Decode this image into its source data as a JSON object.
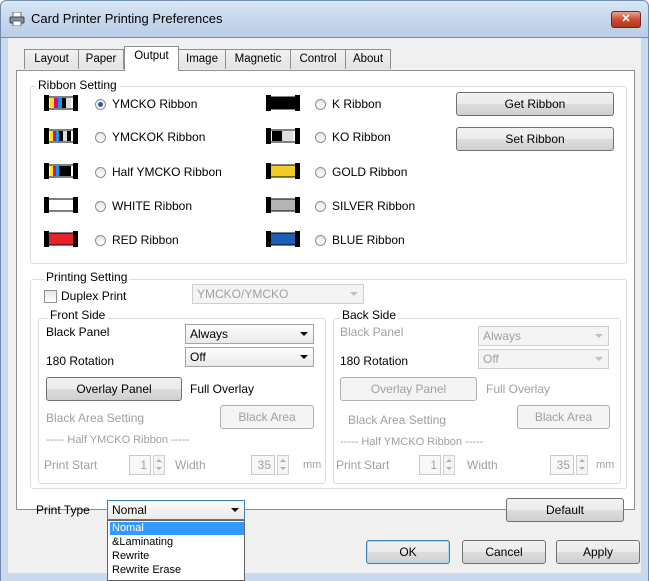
{
  "window": {
    "title": "Card Printer Printing Preferences",
    "close_label": "✕"
  },
  "tabs": [
    "Layout",
    "Paper",
    "Output",
    "Image",
    "Magnetic",
    "Control",
    "About"
  ],
  "ribbon_setting": {
    "legend": "Ribbon Setting",
    "left": [
      "YMCKO Ribbon",
      "YMCKOK Ribbon",
      "Half YMCKO Ribbon",
      "WHITE Ribbon",
      "RED Ribbon"
    ],
    "right": [
      "K Ribbon",
      "KO Ribbon",
      "GOLD Ribbon",
      "SILVER Ribbon",
      "BLUE Ribbon"
    ],
    "selected": "YMCKO Ribbon",
    "get_button": "Get Ribbon",
    "set_button": "Set Ribbon",
    "colors": {
      "red": "#e8222a",
      "gold": "#f2cc22",
      "silver": "#b4b4b4",
      "blue": "#1d5eb6",
      "black": "#000000"
    }
  },
  "printing_setting": {
    "legend": "Printing Setting",
    "duplex_label": "Duplex Print",
    "duplex_checked": false,
    "duplex_mode": "YMCKO/YMCKO",
    "front": {
      "legend": "Front Side",
      "black_panel_label": "Black Panel",
      "black_panel_value": "Always",
      "rotation_label": "180 Rotation",
      "rotation_value": "Off",
      "overlay_button": "Overlay Panel",
      "overlay_value": "Full Overlay",
      "black_area_label": "Black Area Setting",
      "black_area_button": "Black Area",
      "half_label": "----- Half YMCKO Ribbon -----",
      "print_start_label": "Print Start",
      "print_start_value": "1",
      "width_label": "Width",
      "width_value": "35",
      "unit": "mm"
    },
    "back": {
      "legend": "Back Side",
      "black_panel_label": "Black Panel",
      "black_panel_value": "Always",
      "rotation_label": "180 Rotation",
      "rotation_value": "Off",
      "overlay_button": "Overlay Panel",
      "overlay_value": "Full Overlay",
      "black_area_label": "Black Area Setting",
      "black_area_button": "Black Area",
      "half_label": "----- Half YMCKO Ribbon -----",
      "print_start_label": "Print Start",
      "print_start_value": "1",
      "width_label": "Width",
      "width_value": "35",
      "unit": "mm"
    }
  },
  "print_type": {
    "label": "Print Type",
    "value": "Nomal",
    "options": [
      "Nomal",
      "&Laminating",
      "Rewrite",
      "Rewrite Erase"
    ]
  },
  "buttons": {
    "default": "Default",
    "ok": "OK",
    "cancel": "Cancel",
    "apply": "Apply"
  }
}
